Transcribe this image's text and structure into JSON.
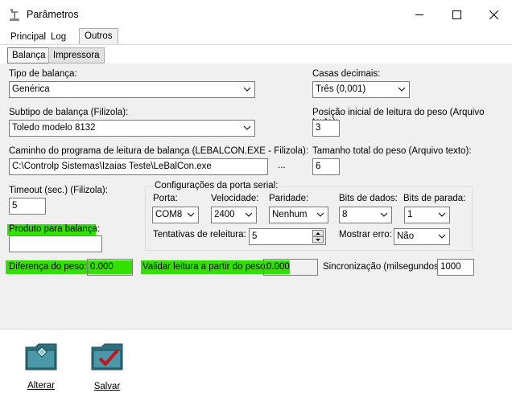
{
  "window": {
    "title": "Parâmetros"
  },
  "tabs": [
    "Principal",
    "Log",
    "Outros"
  ],
  "subtabs": [
    "Balança",
    "Impressora"
  ],
  "fields": {
    "tipo_label": "Tipo de balança:",
    "tipo_value": "Genérica",
    "subtipo_label": "Subtipo de balança (Filizola):",
    "subtipo_value": "Toledo modelo 8132",
    "caminho_label": "Caminho do programa de leitura de balança (LEBALCON.EXE - Filizola):",
    "caminho_value": "C:\\Controlp Sistemas\\Izaias Teste\\LeBalCon.exe",
    "browse_label": "...",
    "casas_label": "Casas decimais:",
    "casas_value": "Três (0,001)",
    "posicao_label": "Posição inicial de leitura do peso (Arquivo texto):",
    "posicao_value": "3",
    "tamanho_label": "Tamanho total do peso (Arquivo texto):",
    "tamanho_value": "6",
    "timeout_label": "Timeout (sec.) (Filizola):",
    "timeout_value": "5",
    "produto_label": "Produto para balança:",
    "produto_value": "",
    "diferenca_label": "Diferença do peso:",
    "diferenca_value": "0.000",
    "validar_label": "Validar leitura a partir do peso:",
    "validar_value": "0.000",
    "sincronizacao_label": "Sincronização (milsegundos):",
    "sincronizacao_value": "1000"
  },
  "serial": {
    "title": "Configurações da porta serial:",
    "porta_label": "Porta:",
    "porta_value": "COM8",
    "velocidade_label": "Velocidade:",
    "velocidade_value": "2400",
    "paridade_label": "Paridade:",
    "paridade_value": "Nenhum",
    "bits_dados_label": "Bits de dados:",
    "bits_dados_value": "8",
    "bits_parada_label": "Bits de parada:",
    "bits_parada_value": "1",
    "tentativas_label": "Tentativas de releitura:",
    "tentativas_value": "5",
    "mostrar_erro_label": "Mostrar erro:",
    "mostrar_erro_value": "Não"
  },
  "toolbar": {
    "alterar_label": "Alterar",
    "salvar_label": "Salvar"
  },
  "colors": {
    "highlight": "#33e000"
  }
}
